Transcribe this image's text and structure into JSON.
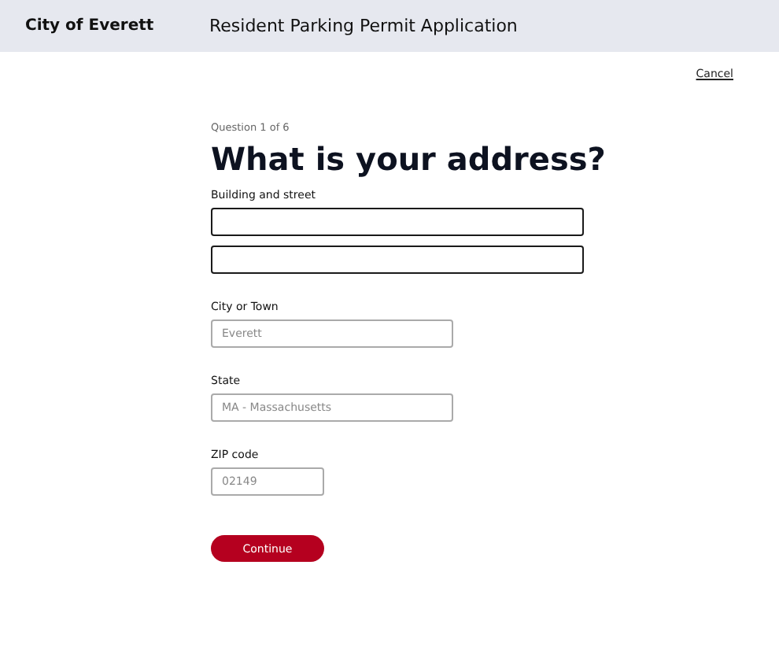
{
  "header": {
    "brand": "City of Everett",
    "title": "Resident Parking Permit Application"
  },
  "cancel": "Cancel",
  "progress": "Question 1 of 6",
  "heading": "What is your address?",
  "fields": [
    {
      "label": "Building and street",
      "inputs": [
        {
          "kind": "wide",
          "highlighted": true
        },
        {
          "kind": "wide",
          "highlighted": true
        }
      ]
    },
    {
      "label": "City or Town",
      "inputs": [
        {
          "kind": "medium",
          "highlighted": false,
          "placeholder": "Everett"
        }
      ]
    },
    {
      "label": "State",
      "inputs": [
        {
          "kind": "medium",
          "highlighted": false,
          "placeholder": "MA - Massachusetts"
        }
      ]
    },
    {
      "label": "ZIP code",
      "inputs": [
        {
          "kind": "short",
          "highlighted": false,
          "placeholder": "02149"
        }
      ]
    }
  ],
  "continue": "Continue"
}
